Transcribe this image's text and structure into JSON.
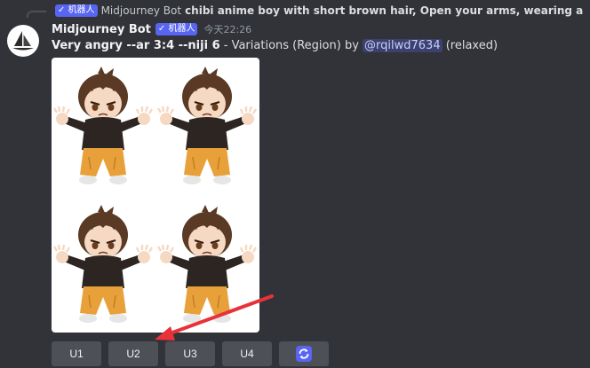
{
  "reply": {
    "bot_tag": "✓ 机器人",
    "name": "Midjourney Bot",
    "text": "chibi anime boy with short brown hair, Open your arms, wearing a black h"
  },
  "message": {
    "username": "Midjourney Bot",
    "bot_tag": "✓ 机器人",
    "timestamp": "今天22:26",
    "prompt": "Very angry --ar 3:4 --niji 6",
    "suffix": " - Variations (Region) by ",
    "mention": "@rqilwd7634",
    "mode": " (relaxed)"
  },
  "buttons": {
    "u1": "U1",
    "u2": "U2",
    "u3": "U3",
    "u4": "U4",
    "refresh_icon": "refresh-icon"
  },
  "colors": {
    "background": "#313338",
    "bot_tag": "#5865f2",
    "button": "#4e5058",
    "refresh_button": "#5865f2",
    "annotation_arrow": "#e8323a"
  }
}
